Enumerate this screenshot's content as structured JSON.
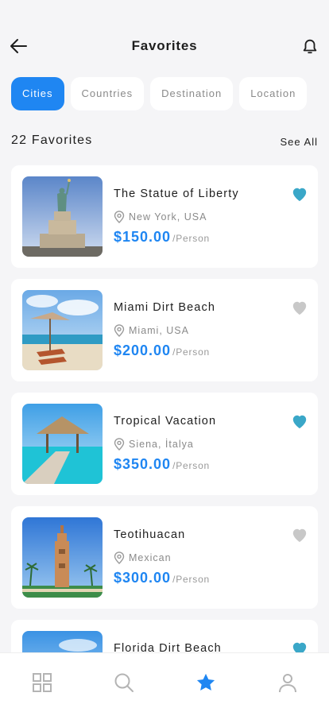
{
  "header": {
    "title": "Favorites"
  },
  "tabs": [
    {
      "label": "Cities",
      "active": true
    },
    {
      "label": "Countries",
      "active": false
    },
    {
      "label": "Destination",
      "active": false
    },
    {
      "label": "Location",
      "active": false
    }
  ],
  "summary": {
    "count_label": "22 Favorites",
    "see_all": "See All"
  },
  "favorites": [
    {
      "name": "The Statue of Liberty",
      "location": "New York, USA",
      "price": "$150.00",
      "unit": "/Person",
      "liked": true
    },
    {
      "name": "Miami Dirt Beach",
      "location": "Miami, USA",
      "price": "$200.00",
      "unit": "/Person",
      "liked": false
    },
    {
      "name": "Tropical Vacation",
      "location": "Siena, İtalya",
      "price": "$350.00",
      "unit": "/Person",
      "liked": true
    },
    {
      "name": "Teotihuacan",
      "location": "Mexican",
      "price": "$300.00",
      "unit": "/Person",
      "liked": false
    },
    {
      "name": "Florida Dirt Beach",
      "liked": true
    }
  ],
  "nav": [
    {
      "icon": "grid-icon",
      "active": false
    },
    {
      "icon": "search-icon",
      "active": false
    },
    {
      "icon": "star-icon",
      "active": true
    },
    {
      "icon": "user-icon",
      "active": false
    }
  ],
  "colors": {
    "accent": "#1f86f2",
    "liked": "#3aa7c8",
    "unliked": "#c8c8c8"
  }
}
